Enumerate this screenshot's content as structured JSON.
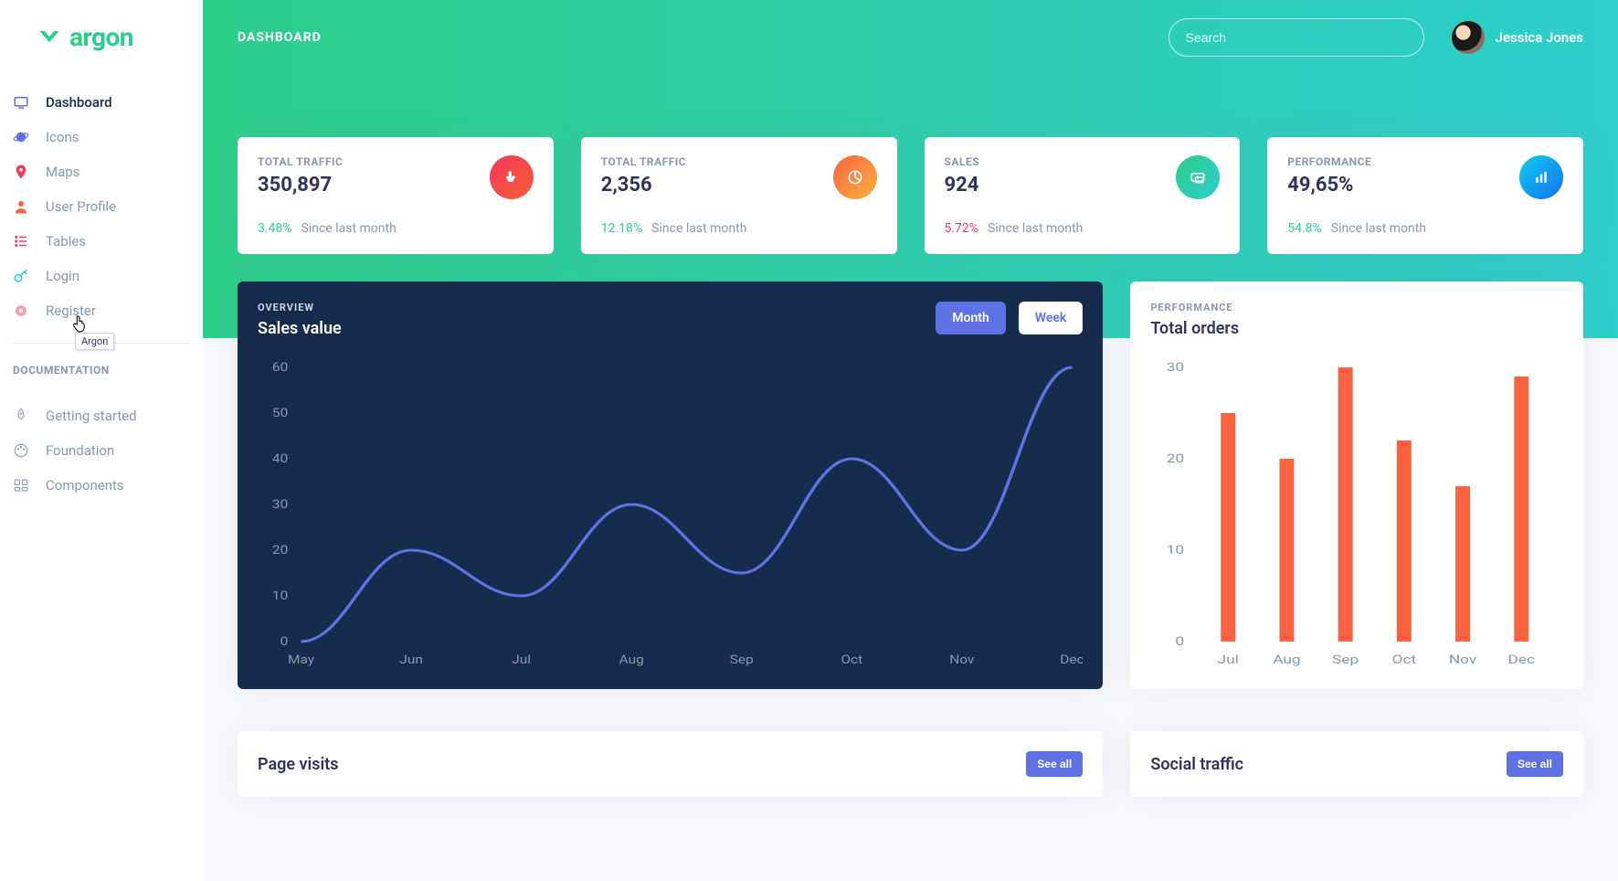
{
  "brand": {
    "name": "argon"
  },
  "header": {
    "title": "DASHBOARD",
    "search_placeholder": "Search",
    "user_name": "Jessica Jones"
  },
  "tooltip": {
    "text": "Argon"
  },
  "sidebar": {
    "items": [
      {
        "label": "Dashboard",
        "icon": "tv-icon",
        "color": "#5e72e4",
        "active": true
      },
      {
        "label": "Icons",
        "icon": "planet-icon",
        "color": "#5e72e4"
      },
      {
        "label": "Maps",
        "icon": "pin-icon",
        "color": "#f5365c"
      },
      {
        "label": "User Profile",
        "icon": "user-icon",
        "color": "#fb6340"
      },
      {
        "label": "Tables",
        "icon": "list-icon",
        "color": "#f5365c"
      },
      {
        "label": "Login",
        "icon": "key-icon",
        "color": "#11cdef"
      },
      {
        "label": "Register",
        "icon": "circle-icon",
        "color": "#fb9aa8"
      }
    ],
    "docs_heading": "DOCUMENTATION",
    "docs": [
      {
        "label": "Getting started",
        "icon": "rocket-icon"
      },
      {
        "label": "Foundation",
        "icon": "palette-icon"
      },
      {
        "label": "Components",
        "icon": "ui-icon"
      }
    ]
  },
  "stats": [
    {
      "title": "TOTAL TRAFFIC",
      "value": "350,897",
      "change": "3.48%",
      "direction": "up",
      "period": "Since last month",
      "icon": "hand-icon",
      "gradient": [
        "#f5365c",
        "#f56036"
      ]
    },
    {
      "title": "TOTAL TRAFFIC",
      "value": "2,356",
      "change": "12.18%",
      "direction": "up",
      "period": "Since last month",
      "icon": "pie-icon",
      "gradient": [
        "#fb6340",
        "#fbb140"
      ]
    },
    {
      "title": "SALES",
      "value": "924",
      "change": "5.72%",
      "direction": "down",
      "period": "Since last month",
      "icon": "money-icon",
      "gradient": [
        "#2dce89",
        "#2dcecc"
      ]
    },
    {
      "title": "PERFORMANCE",
      "value": "49,65%",
      "change": "54.8%",
      "direction": "up",
      "period": "Since last month",
      "icon": "bar-icon",
      "gradient": [
        "#11cdef",
        "#1171ef"
      ]
    }
  ],
  "sales_chart": {
    "overline": "OVERVIEW",
    "title": "Sales value",
    "pills": {
      "month": "Month",
      "week": "Week"
    }
  },
  "orders_chart": {
    "overline": "PERFORMANCE",
    "title": "Total orders"
  },
  "tables": {
    "page_visits": {
      "title": "Page visits",
      "button": "See all"
    },
    "social_traffic": {
      "title": "Social traffic",
      "button": "See all"
    }
  },
  "chart_data": [
    {
      "type": "line",
      "title": "Sales value",
      "xlabel": "",
      "ylabel": "",
      "ylim": [
        0,
        60
      ],
      "categories": [
        "May",
        "Jun",
        "Jul",
        "Aug",
        "Sep",
        "Oct",
        "Nov",
        "Dec"
      ],
      "values": [
        0,
        20,
        10,
        30,
        15,
        40,
        20,
        60
      ]
    },
    {
      "type": "bar",
      "title": "Total orders",
      "xlabel": "",
      "ylabel": "",
      "ylim": [
        0,
        30
      ],
      "categories": [
        "Jul",
        "Aug",
        "Sep",
        "Oct",
        "Nov",
        "Dec"
      ],
      "values": [
        25,
        20,
        30,
        22,
        17,
        29
      ]
    }
  ]
}
